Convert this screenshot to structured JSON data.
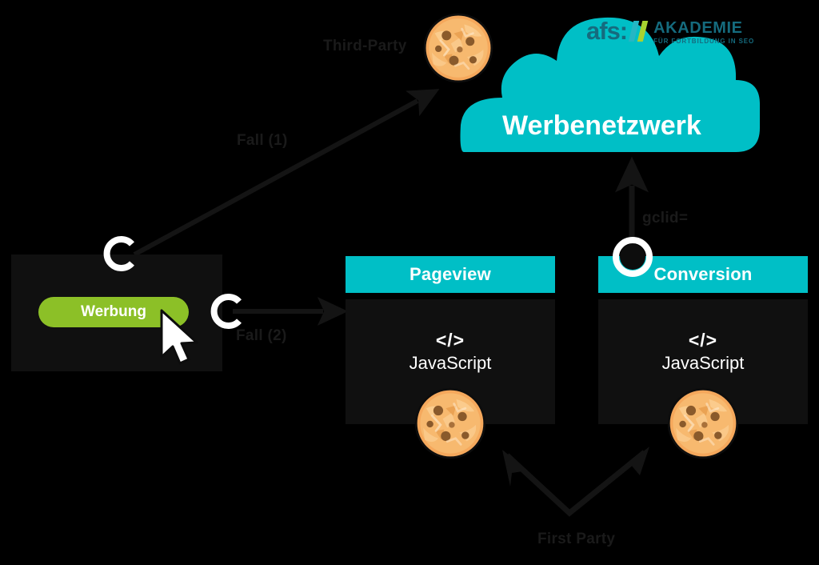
{
  "meta": {
    "title": "Third-Party vs First-Party Cookie Tracking"
  },
  "logo": {
    "brand": "afs:",
    "name": "AKADEMIE",
    "tagline": "FÜR FORTBILDUNG IN SEO",
    "slash_colors": [
      "#25b6c4",
      "#a8d330"
    ]
  },
  "colors": {
    "teal": "#00bfc6",
    "green": "#8cc027",
    "panel": "#101010",
    "background": "#000000",
    "arrow": "#1a1a1a",
    "cookie": "#f2a65a",
    "logo_teal": "#156b7e"
  },
  "cloud": {
    "label": "Werbenetzwerk"
  },
  "labels": {
    "third_party": "Third-Party",
    "first_party": "First Party",
    "case_one": "Fall (1)",
    "case_two": "Fall (2)",
    "gclid": "gclid="
  },
  "ad_box": {
    "button_label": "Werbung"
  },
  "panels": [
    {
      "id": "pageview",
      "header": "Pageview",
      "code": "</>",
      "tech": "JavaScript"
    },
    {
      "id": "conversion",
      "header": "Conversion",
      "code": "</>",
      "tech": "JavaScript"
    }
  ],
  "markers": [
    {
      "id": "ad-box-top",
      "type": "ring-open"
    },
    {
      "id": "ad-click",
      "type": "ring-open"
    },
    {
      "id": "conversion-gclid",
      "type": "ring-filled"
    }
  ]
}
